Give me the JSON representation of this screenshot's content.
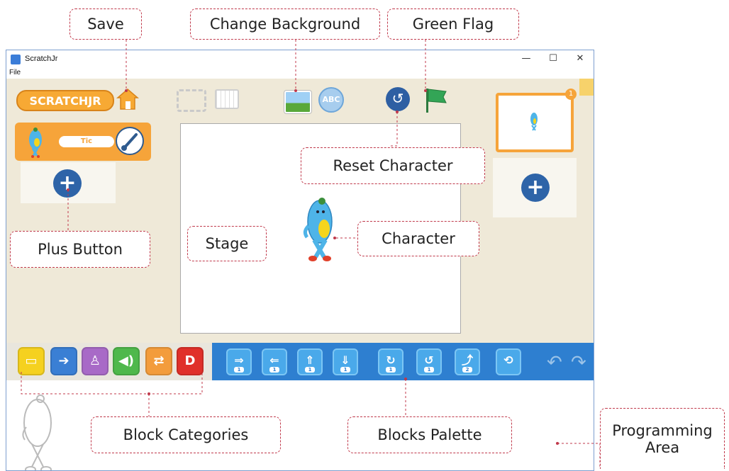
{
  "window": {
    "title": "ScratchJr",
    "menu": [
      "File"
    ],
    "controls": {
      "minimize": "—",
      "maximize": "☐",
      "close": "✕"
    }
  },
  "toolbar": {
    "logo": "SCRATCHJR"
  },
  "sprite": {
    "name": "Tic"
  },
  "pages": {
    "current_number": "1"
  },
  "blocks": {
    "motion": [
      {
        "glyph": "⇒",
        "count": "1"
      },
      {
        "glyph": "⇐",
        "count": "1"
      },
      {
        "glyph": "⇑",
        "count": "1"
      },
      {
        "glyph": "⇓",
        "count": "1"
      },
      {
        "glyph": "↻",
        "count": "1"
      },
      {
        "glyph": "↺",
        "count": "1"
      },
      {
        "glyph": "⤴",
        "count": "2"
      },
      {
        "glyph": "⟲",
        "count": ""
      }
    ]
  },
  "annotations": {
    "save": "Save",
    "change_background": "Change Background",
    "green_flag": "Green Flag",
    "reset_character": "Reset Character",
    "stage": "Stage",
    "character": "Character",
    "plus_button": "Plus Button",
    "block_categories": "Block Categories",
    "blocks_palette": "Blocks Palette",
    "programming_area_line1": "Programming",
    "programming_area_line2": "Area"
  },
  "colors": {
    "accent_orange": "#f6a43a",
    "palette_blue": "#2e7fd0",
    "callout_border": "#c0394b"
  }
}
